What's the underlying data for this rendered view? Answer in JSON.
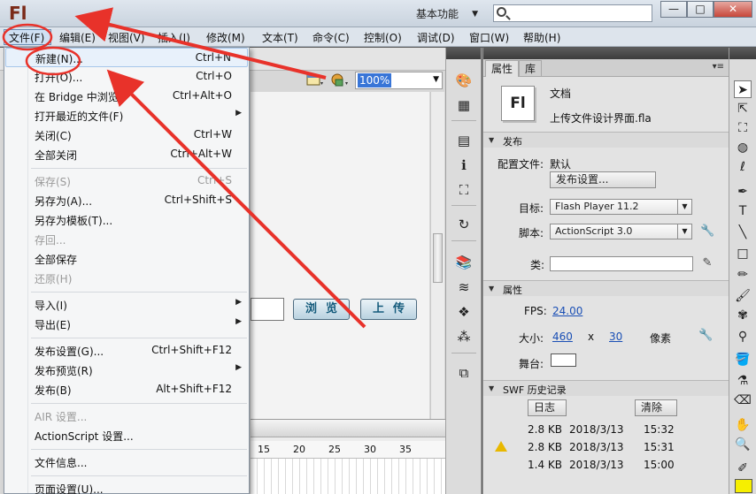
{
  "titlebar": {
    "logo": "Fl",
    "workspace": "基本功能",
    "search_placeholder": "",
    "minimize": "—",
    "maximize": "□",
    "close": "✕"
  },
  "menubar": [
    "文件(F)",
    "编辑(E)",
    "视图(V)",
    "插入(I)",
    "修改(M)",
    "文本(T)",
    "命令(C)",
    "控制(O)",
    "调试(D)",
    "窗口(W)",
    "帮助(H)"
  ],
  "file_menu": [
    {
      "label": "新建(N)...",
      "shortcut": "Ctrl+N",
      "state": "hover"
    },
    {
      "label": "打开(O)...",
      "shortcut": "Ctrl+O"
    },
    {
      "label": "在 Bridge 中浏览",
      "shortcut": "Ctrl+Alt+O"
    },
    {
      "label": "打开最近的文件(F)",
      "shortcut": "",
      "submenu": true
    },
    {
      "label": "关闭(C)",
      "shortcut": "Ctrl+W"
    },
    {
      "label": "全部关闭",
      "shortcut": "Ctrl+Alt+W"
    },
    {
      "separator": true
    },
    {
      "label": "保存(S)",
      "shortcut": "Ctrl+S",
      "state": "disabled"
    },
    {
      "label": "另存为(A)...",
      "shortcut": "Ctrl+Shift+S"
    },
    {
      "label": "另存为模板(T)...",
      "shortcut": ""
    },
    {
      "label": "存回...",
      "shortcut": "",
      "state": "disabled"
    },
    {
      "label": "全部保存",
      "shortcut": ""
    },
    {
      "label": "还原(H)",
      "shortcut": "",
      "state": "disabled"
    },
    {
      "separator": true
    },
    {
      "label": "导入(I)",
      "shortcut": "",
      "submenu": true
    },
    {
      "label": "导出(E)",
      "shortcut": "",
      "submenu": true
    },
    {
      "separator": true
    },
    {
      "label": "发布设置(G)...",
      "shortcut": "Ctrl+Shift+F12"
    },
    {
      "label": "发布预览(R)",
      "shortcut": "",
      "submenu": true
    },
    {
      "label": "发布(B)",
      "shortcut": "Alt+Shift+F12"
    },
    {
      "separator": true
    },
    {
      "label": "AIR 设置...",
      "shortcut": "",
      "state": "disabled"
    },
    {
      "label": "ActionScript 设置...",
      "shortcut": ""
    },
    {
      "separator": true
    },
    {
      "label": "文件信息...",
      "shortcut": ""
    },
    {
      "separator": true
    },
    {
      "label": "页面设置(U)...",
      "shortcut": ""
    }
  ],
  "stage": {
    "zoom": "100%",
    "button_browse": "浏览",
    "button_upload": "上传"
  },
  "timeline": {
    "ruler": [
      "15",
      "20",
      "25",
      "30",
      "35"
    ]
  },
  "props": {
    "tab_properties": "属性",
    "tab_library": "库",
    "doc_icon_text": "Fl",
    "doc_type": "文档",
    "doc_name": "上传文件设计界面.fla",
    "section_publish": "发布",
    "profile_label": "配置文件:",
    "profile_value": "默认",
    "publish_settings_btn": "发布设置...",
    "target_label": "目标:",
    "target_value": "Flash Player 11.2",
    "script_label": "脚本:",
    "script_value": "ActionScript 3.0",
    "class_label": "类:",
    "section_properties": "属性",
    "fps_label": "FPS:",
    "fps_value": "24.00",
    "size_label": "大小:",
    "width_value": "460",
    "x_label": "x",
    "height_value": "30",
    "unit_label": "像素",
    "stage_label": "舞台:",
    "section_history": "SWF 历史记录",
    "log_btn": "日志",
    "clear_btn": "清除",
    "history": [
      {
        "size": "2.8 KB",
        "date": "2018/3/13",
        "time": "15:32",
        "warning": false
      },
      {
        "size": "2.8 KB",
        "date": "2018/3/13",
        "time": "15:31",
        "warning": true
      },
      {
        "size": "1.4 KB",
        "date": "2018/3/13",
        "time": "15:00",
        "warning": false
      }
    ]
  },
  "colors": {
    "annotation_red": "#e8322a",
    "stage_color": "#ffffff",
    "fill_swatch": "#f6ef00"
  }
}
